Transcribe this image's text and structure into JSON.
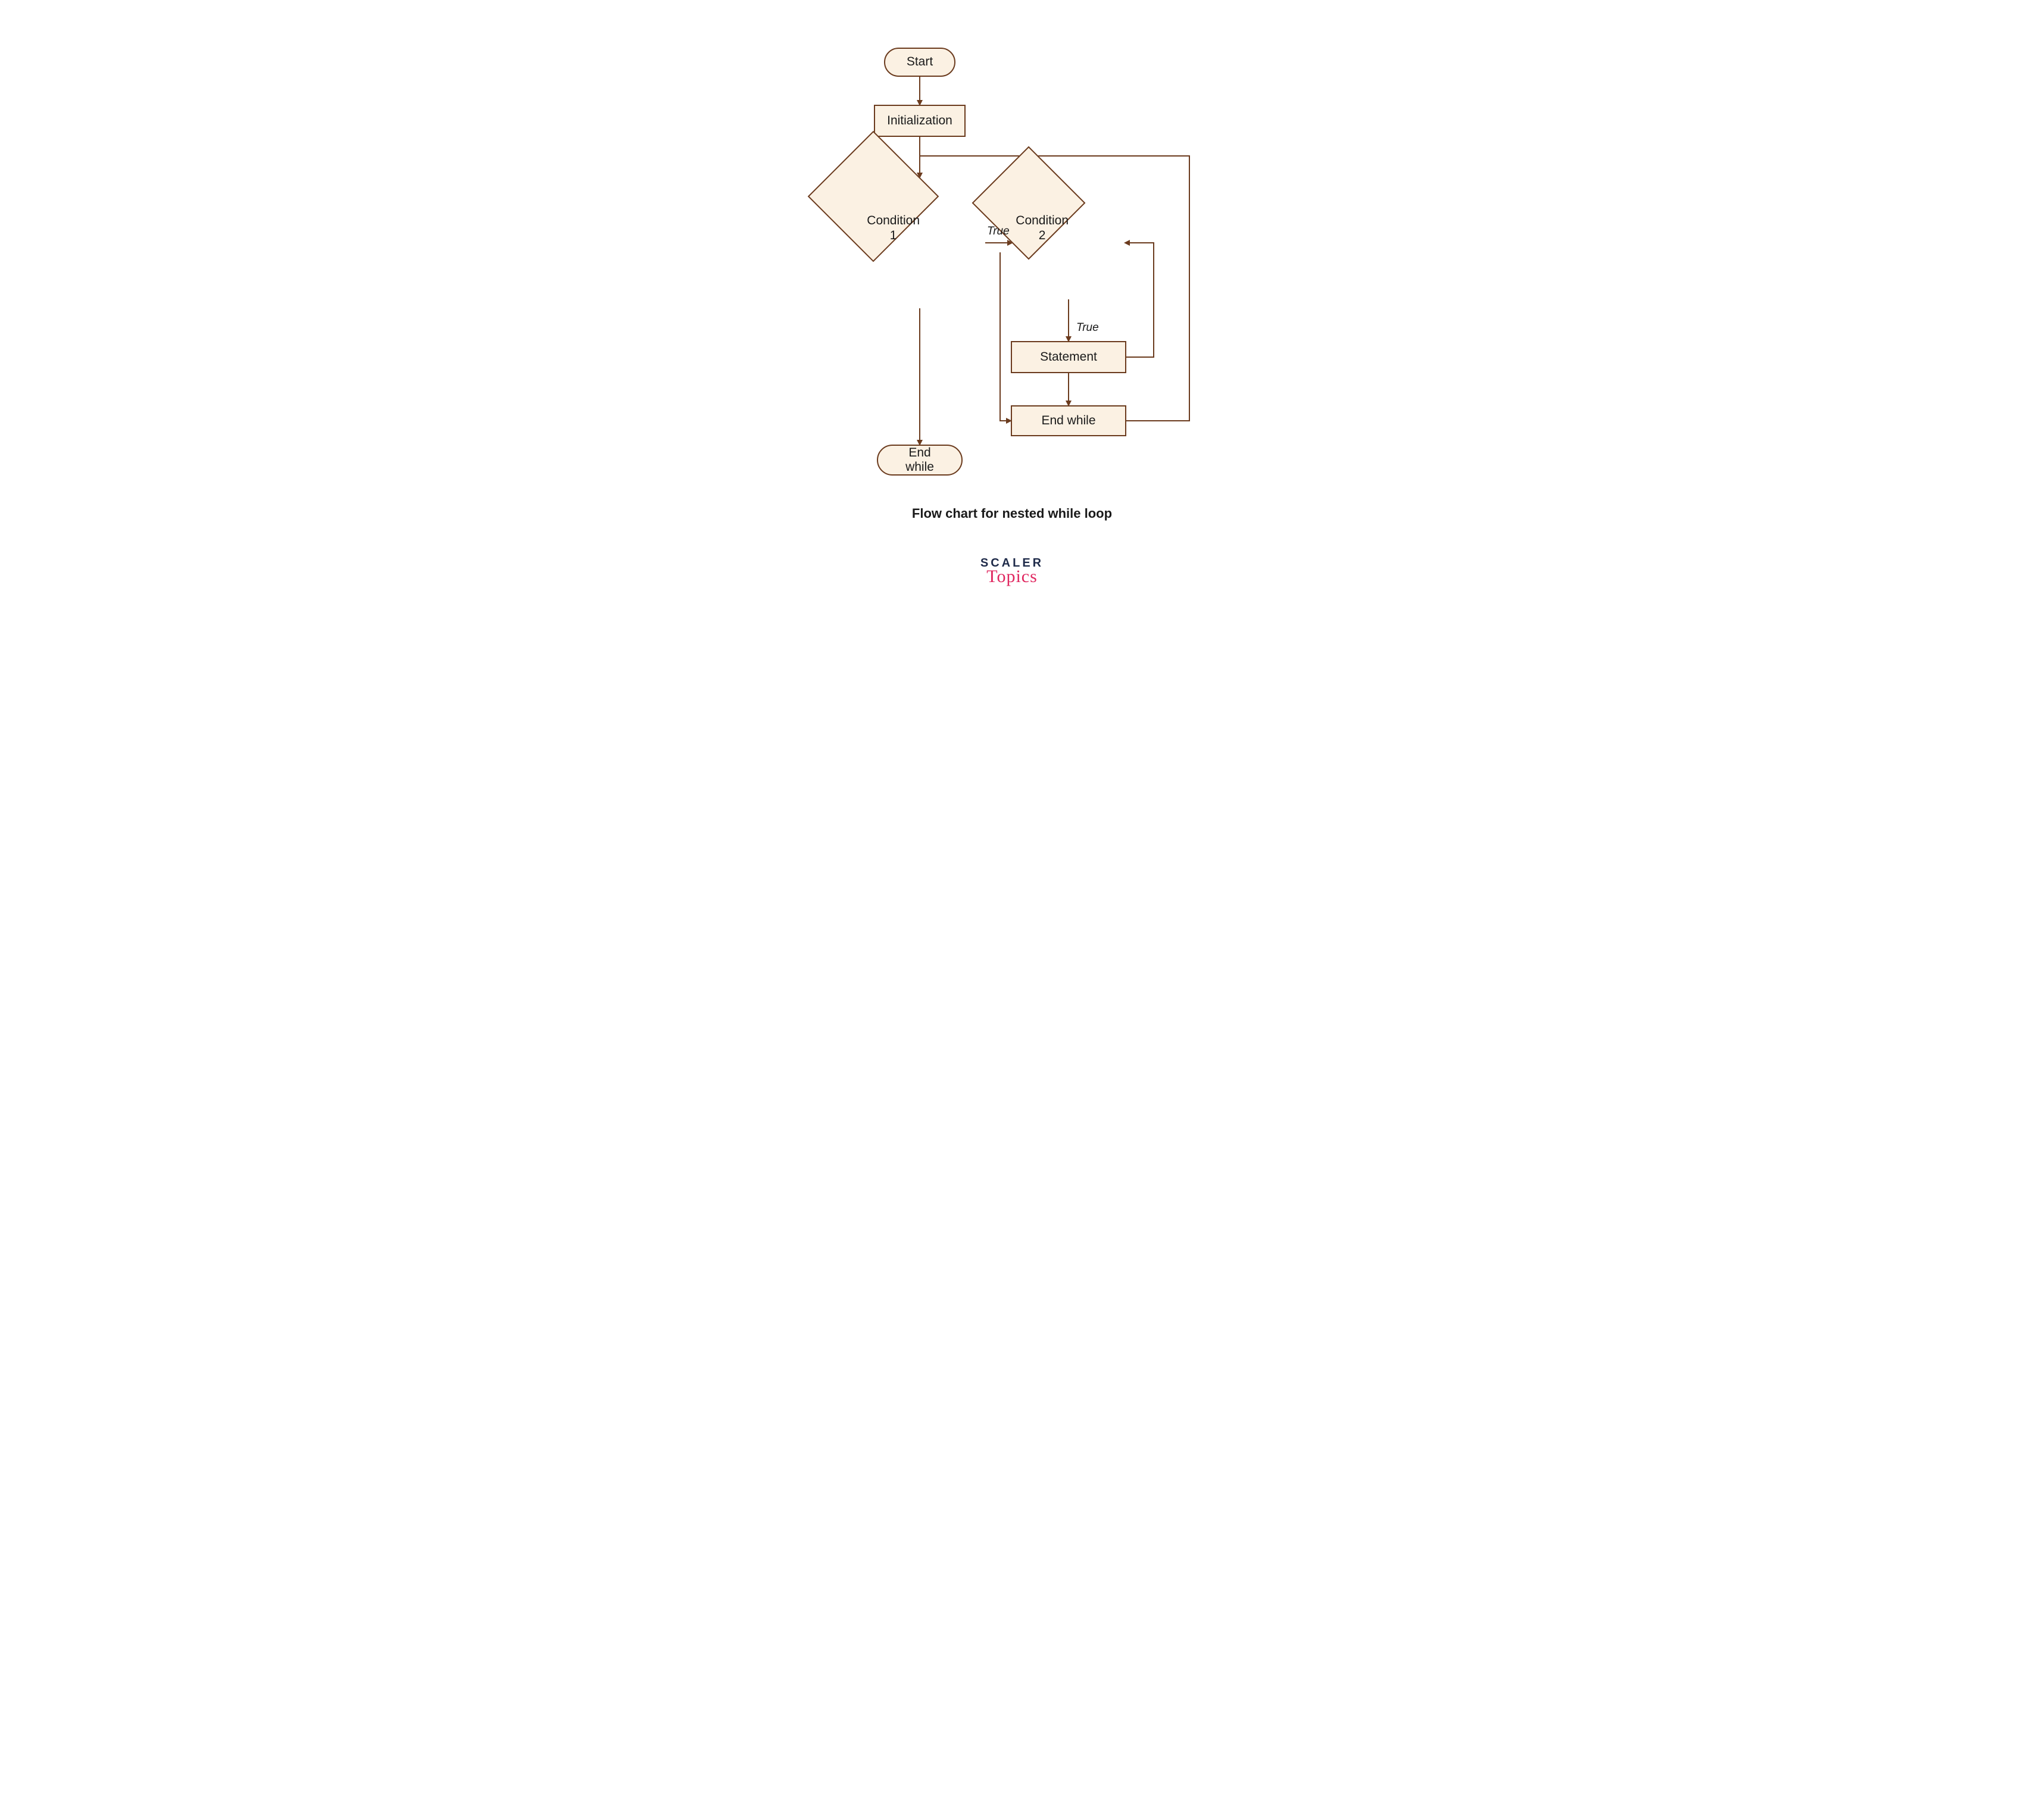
{
  "nodes": {
    "start": {
      "text": "Start"
    },
    "initialization": {
      "text": "Initialization"
    },
    "condition1": {
      "text": "Condition\n1"
    },
    "condition2": {
      "text": "Condition\n2"
    },
    "statement": {
      "text": "Statement"
    },
    "end_inner": {
      "text": "End while"
    },
    "end_outer": {
      "text": "End while"
    }
  },
  "edge_labels": {
    "cond1_true": "True",
    "cond2_true": "True"
  },
  "caption": "Flow chart for nested while loop",
  "brand": {
    "line1": "SCALER",
    "line2": "Topics"
  },
  "colors": {
    "node_fill": "#fbf1e3",
    "node_stroke": "#6b3b1e",
    "arrow": "#6b3b1e"
  }
}
